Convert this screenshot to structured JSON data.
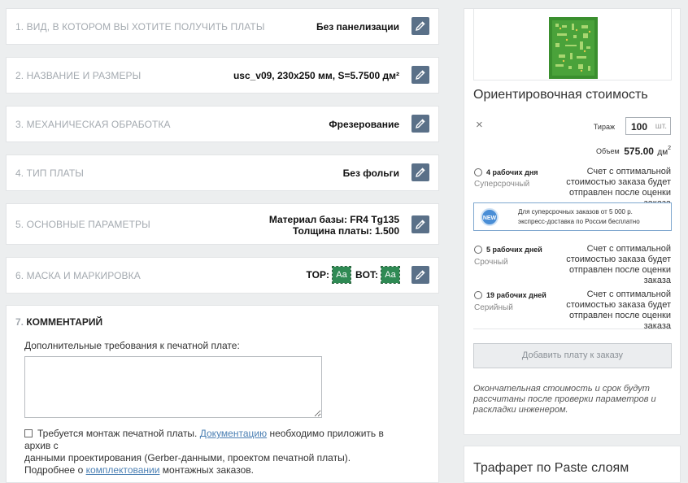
{
  "steps": [
    {
      "num": "1.",
      "title": "ВИД, В КОТОРОМ ВЫ ХОТИТЕ ПОЛУЧИТЬ ПЛАТЫ",
      "value": "Без панелизации"
    },
    {
      "num": "2.",
      "title": "НАЗВАНИЕ И РАЗМЕРЫ",
      "value": "usc_v09, 230x250 мм, S=5.7500 дм²"
    },
    {
      "num": "3.",
      "title": "МЕХАНИЧЕСКАЯ ОБРАБОТКА",
      "value": "Фрезерование"
    },
    {
      "num": "4.",
      "title": "ТИП ПЛАТЫ",
      "value": "Без фольги"
    },
    {
      "num": "5.",
      "title": "ОСНОВНЫЕ ПАРАМЕТРЫ",
      "value_line1": "Материал базы: FR4 Tg135",
      "value_line2": "Толщина платы: 1.500"
    },
    {
      "num": "6.",
      "title": "МАСКА И МАРКИРОВКА",
      "top_label": "TOP:",
      "bot_label": "BOT:",
      "swatch_text": "Aa"
    }
  ],
  "comment": {
    "num": "7.",
    "title": "КОММЕНТАРИЙ",
    "field_label": "Дополнительные требования к печатной плате:",
    "textarea_value": "",
    "montage_text_1": "Требуется монтаж печатной платы.",
    "montage_link_1": "Документацию",
    "montage_text_2": "необходимо приложить в архив с",
    "montage_text_3": "данными проектирования (Gerber-данными, проектом печатной платы).",
    "montage_text_4": "Подробнее о",
    "montage_link_2": "комплектовании",
    "montage_text_5": "монтажных заказов."
  },
  "estimate": {
    "title": "Ориентировочная стоимость",
    "close_symbol": "×",
    "qty_label": "Тираж",
    "qty_value": "100",
    "qty_unit": "шт.",
    "volume_label": "Объем",
    "volume_value": "575.00",
    "volume_unit": "дм",
    "volume_sup": "2",
    "options": [
      {
        "days": "4 рабочих дня",
        "type": "Суперсрочный",
        "desc": "Счет с оптимальной стоимостью заказа будет отправлен после оценки заказа"
      },
      {
        "days": "5 рабочих дней",
        "type": "Срочный",
        "desc": "Счет с оптимальной стоимостью заказа будет отправлен после оценки заказа"
      },
      {
        "days": "19 рабочих дней",
        "type": "Серийный",
        "desc": "Счет с оптимальной стоимостью заказа будет отправлен после оценки заказа"
      }
    ],
    "promo_badge": "NEW",
    "promo_line1": "Для суперсрочных заказов от 5 000 р.",
    "promo_line2": "экспресс-доставка по России бесплатно",
    "add_button": "Добавить плату к заказу",
    "note": "Окончательная стоимость и срок будут рассчитаны после проверки параметров и раскладки инженером."
  },
  "stencil": {
    "title": "Трафарет по Paste слоям"
  },
  "colors": {
    "accent": "#5a7088",
    "mask_green": "#2f8a54",
    "link": "#4a7fb3"
  }
}
